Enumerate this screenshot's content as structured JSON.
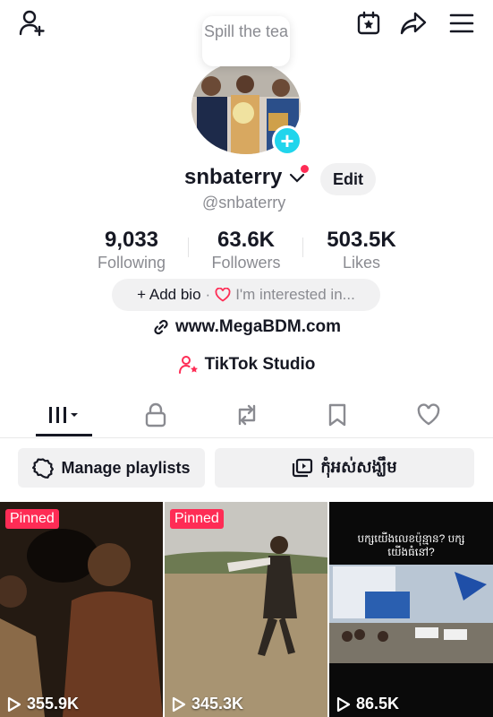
{
  "header": {
    "add_friend_icon": "person-plus-icon",
    "favorites_icon": "calendar-star-icon",
    "share_icon": "share-arrow-icon",
    "menu_icon": "hamburger-menu-icon"
  },
  "bubble": {
    "text": "Spill the tea"
  },
  "profile": {
    "username": "snbaterry",
    "handle": "@snbaterry",
    "edit_label": "Edit"
  },
  "stats": [
    {
      "value": "9,033",
      "label": "Following"
    },
    {
      "value": "63.6K",
      "label": "Followers"
    },
    {
      "value": "503.5K",
      "label": "Likes"
    }
  ],
  "bio": {
    "add_bio": "+ Add bio",
    "separator": "·",
    "interests": "I'm interested in..."
  },
  "link": {
    "url": "www.MegaBDM.com"
  },
  "studio": {
    "label": "TikTok Studio"
  },
  "tabs": [
    {
      "name": "videos",
      "icon": "grid-bars-icon",
      "active": true
    },
    {
      "name": "private",
      "icon": "lock-icon",
      "active": false
    },
    {
      "name": "reposts",
      "icon": "repost-icon",
      "active": false
    },
    {
      "name": "saved",
      "icon": "bookmark-icon",
      "active": false
    },
    {
      "name": "liked",
      "icon": "heart-icon",
      "active": false
    }
  ],
  "playlists": {
    "manage_label": "Manage playlists",
    "second_label": "កុំអស់សង្ឃឹម"
  },
  "videos": [
    {
      "pinned": "Pinned",
      "views": "355.9K"
    },
    {
      "pinned": "Pinned",
      "views": "345.3K"
    },
    {
      "caption": "បក្សយើងលេខប៉ុន្មាន? បក្សយើងធំនៅ?",
      "views": "86.5K"
    }
  ],
  "colors": {
    "accent": "#fe2c55",
    "badge": "#20d5ec",
    "text": "#161823",
    "muted": "#8a8b91"
  }
}
